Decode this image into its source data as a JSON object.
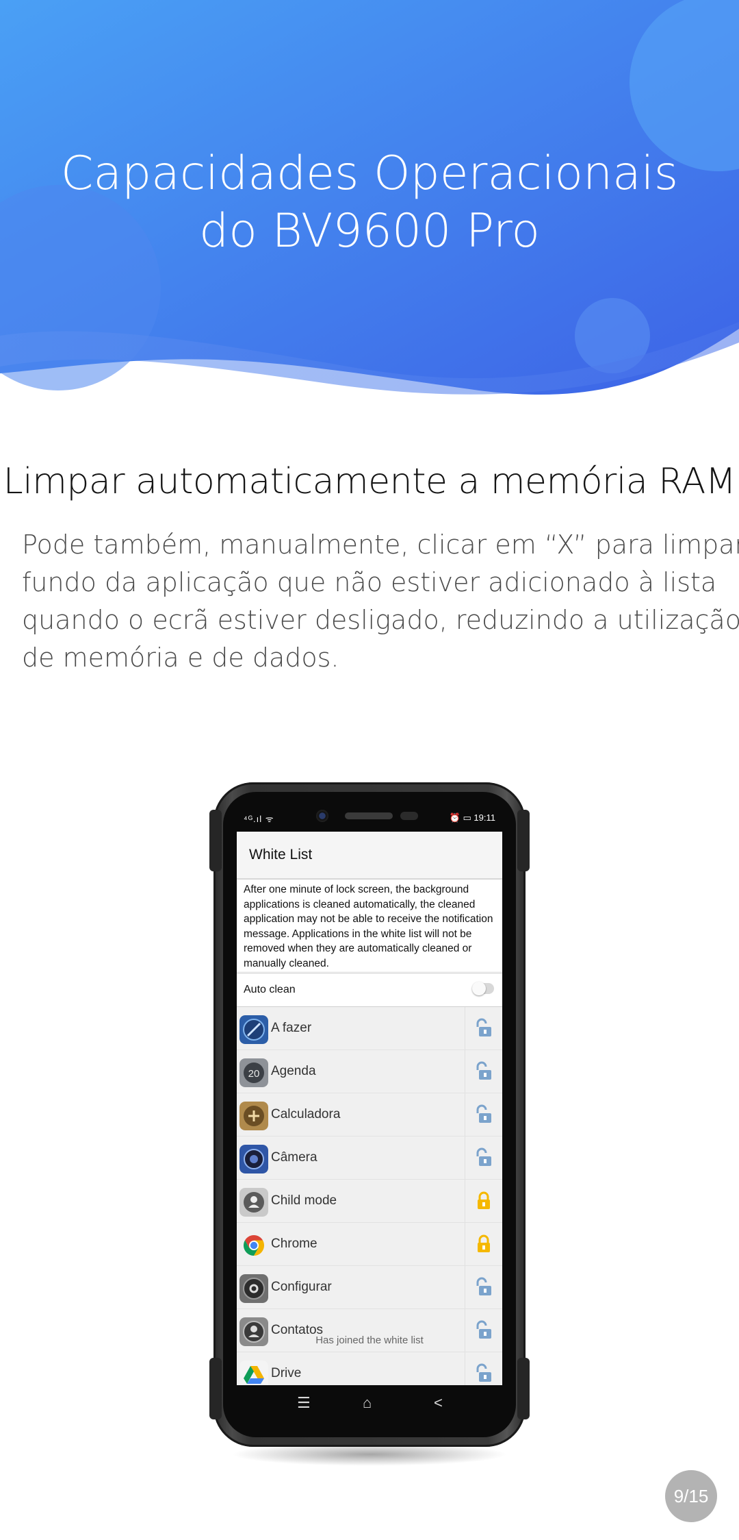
{
  "hero": {
    "title_line1": "Capacidades Operacionais",
    "title_line2": "do BV9600 Pro",
    "gradient": [
      "#4d9df5",
      "#3f6ee8"
    ]
  },
  "section": {
    "title": "Limpar automaticamente a memória RAM",
    "description_lines": [
      "Pode também, manualmente, clicar em “X” para limpar o",
      "fundo da aplicação que não estiver adicionado à lista",
      "quando o ecrã estiver desligado, reduzindo a utilização",
      "de memória e de dados."
    ]
  },
  "phone": {
    "status": {
      "signal": "⁴ᴳ.ıl ᯤ",
      "time": "⏰ ▭ 19:11"
    },
    "screen": {
      "title": "White List",
      "notice": "After one minute of lock screen, the background applications is cleaned automatically, the cleaned application may not be able to receive the notification message. Applications in the white list will not be removed when they are automatically cleaned or manually cleaned.",
      "auto_clean_label": "Auto clean",
      "auto_clean_enabled": false,
      "apps": [
        {
          "name": "A fazer",
          "icon": "todo-icon",
          "locked": false
        },
        {
          "name": "Agenda",
          "icon": "calendar-icon",
          "locked": false
        },
        {
          "name": "Calculadora",
          "icon": "calculator-icon",
          "locked": false
        },
        {
          "name": "Câmera",
          "icon": "camera-icon",
          "locked": false
        },
        {
          "name": "Child mode",
          "icon": "child-mode-icon",
          "locked": true
        },
        {
          "name": "Chrome",
          "icon": "chrome-icon",
          "locked": true
        },
        {
          "name": "Configurar",
          "icon": "settings-icon",
          "locked": false
        },
        {
          "name": "Contatos",
          "icon": "contacts-icon",
          "locked": false
        },
        {
          "name": "Drive",
          "icon": "drive-icon",
          "locked": false
        }
      ],
      "toast": "Has joined the white list"
    },
    "nav": {
      "menu": "☰",
      "home": "⌂",
      "back": "<"
    },
    "colors": {
      "locked": "#f5b800",
      "unlocked": "#7ba3cc"
    }
  },
  "pager": {
    "label": "9/15"
  }
}
